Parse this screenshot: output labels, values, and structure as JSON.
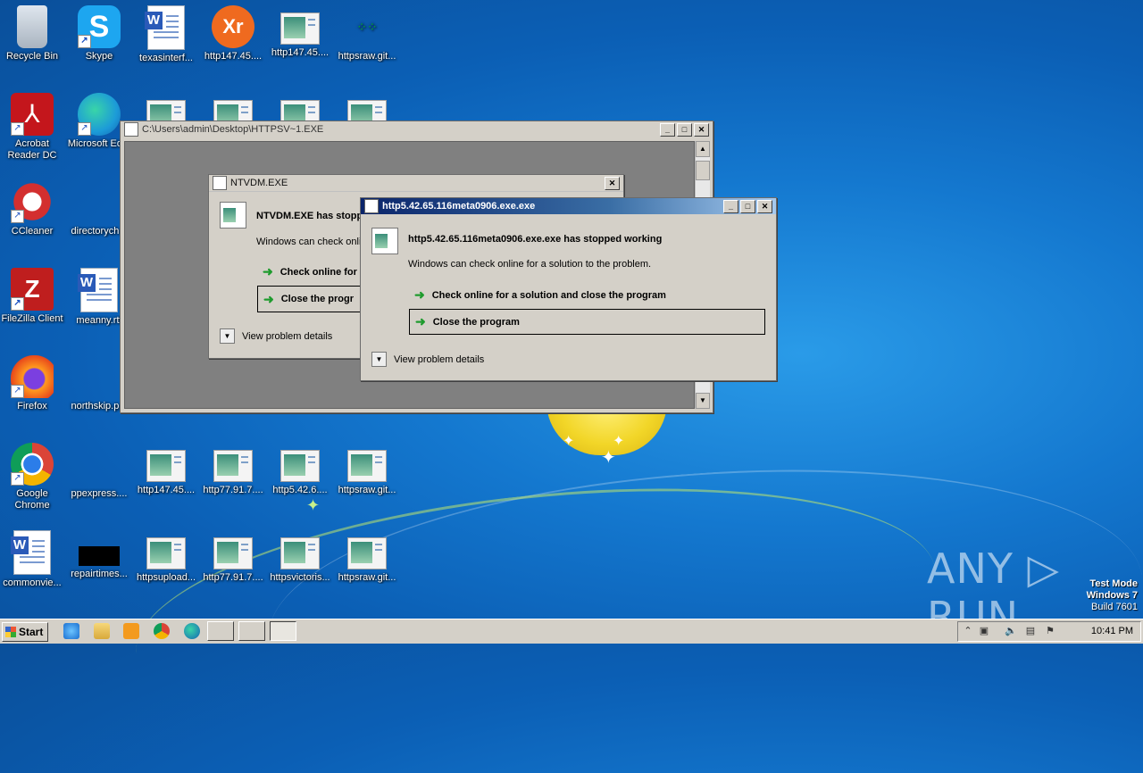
{
  "desktop": {
    "icons": [
      {
        "label": "Recycle Bin"
      },
      {
        "label": "Skype"
      },
      {
        "label": "texasinterf..."
      },
      {
        "label": "http147.45...."
      },
      {
        "label": "http147.45...."
      },
      {
        "label": "httpsraw.git..."
      },
      {
        "label": "Acrobat Reader DC"
      },
      {
        "label": "Microsoft Ed..."
      },
      {
        "label": "CCleaner"
      },
      {
        "label": "directorych..."
      },
      {
        "label": "FileZilla Client"
      },
      {
        "label": "meanny.rtf"
      },
      {
        "label": "Firefox"
      },
      {
        "label": "northskip.p..."
      },
      {
        "label": "Google Chrome"
      },
      {
        "label": "ppexpress...."
      },
      {
        "label": "http147.45...."
      },
      {
        "label": "http77.91.7...."
      },
      {
        "label": "http5.42.6...."
      },
      {
        "label": "httpsraw.git..."
      },
      {
        "label": "commonvie..."
      },
      {
        "label": "repairtimes..."
      },
      {
        "label": "httpsupload..."
      },
      {
        "label": "http77.91.7...."
      },
      {
        "label": "httpsvictoris..."
      },
      {
        "label": "httpsraw.git..."
      }
    ]
  },
  "cmd_window": {
    "title": "C:\\Users\\admin\\Desktop\\HTTPSV~1.EXE"
  },
  "ntvdm_dialog": {
    "title": "NTVDM.EXE",
    "heading": "NTVDM.EXE has stopp",
    "subtext": "Windows can check onlin",
    "option1": "Check online for",
    "option2": "Close the progr",
    "details": "View problem details"
  },
  "http_dialog": {
    "title": "http5.42.65.116meta0906.exe.exe",
    "heading": "http5.42.65.116meta0906.exe.exe has stopped working",
    "subtext": "Windows can check online for a solution to the problem.",
    "option1": "Check online for a solution and close the program",
    "option2": "Close the program",
    "details": "View problem details"
  },
  "taskbar": {
    "start_label": "Start",
    "clock": "10:41 PM"
  },
  "watermark": {
    "text": "ANY ▷ RUN",
    "line1": "Test Mode",
    "line2": "Windows 7",
    "line3": "Build 7601"
  },
  "colors": {
    "active_title": "#0a246a",
    "option_arrow": "#1f9b2e",
    "desktop_bg": "#1478cf"
  }
}
